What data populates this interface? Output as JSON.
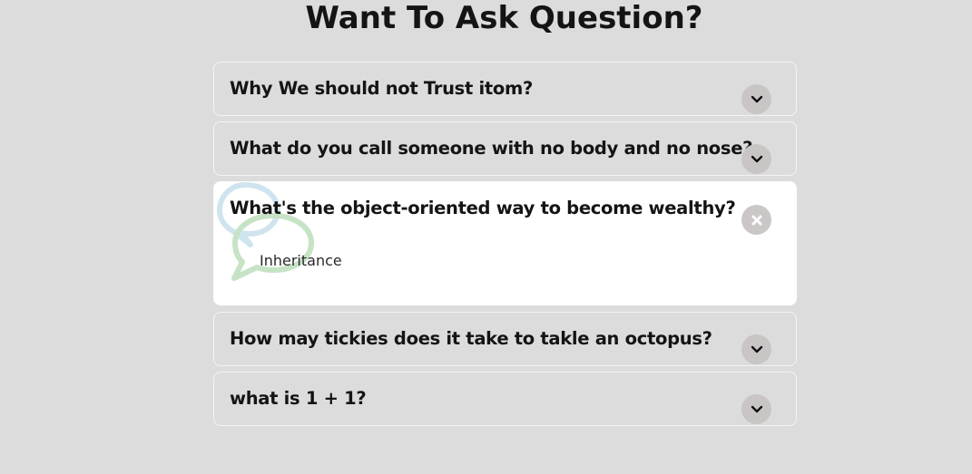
{
  "page": {
    "title": "Want To Ask Question?"
  },
  "faq": [
    {
      "question": "Why We should not Trust itom?",
      "state": "collapsed",
      "answer": ""
    },
    {
      "question": "What do you call someone with no body and no nose?",
      "state": "collapsed",
      "answer": ""
    },
    {
      "question": "What's the object-oriented way to become wealthy?",
      "state": "expanded",
      "answer": "Inheritance"
    },
    {
      "question": "How may tickies does it take to takle an octopus?",
      "state": "collapsed",
      "answer": ""
    },
    {
      "question": "what is 1 + 1?",
      "state": "collapsed",
      "answer": ""
    }
  ],
  "icons": {
    "expand": "chevron-down-icon",
    "collapse": "close-icon",
    "decoration": "chat-bubbles-icon"
  },
  "colors": {
    "background": "#dcdcdc",
    "card_open": "#ffffff",
    "toggle_bg": "#c9c5c5",
    "bubble_blue": "#cfe4ee",
    "bubble_green": "#c6e3c6"
  }
}
